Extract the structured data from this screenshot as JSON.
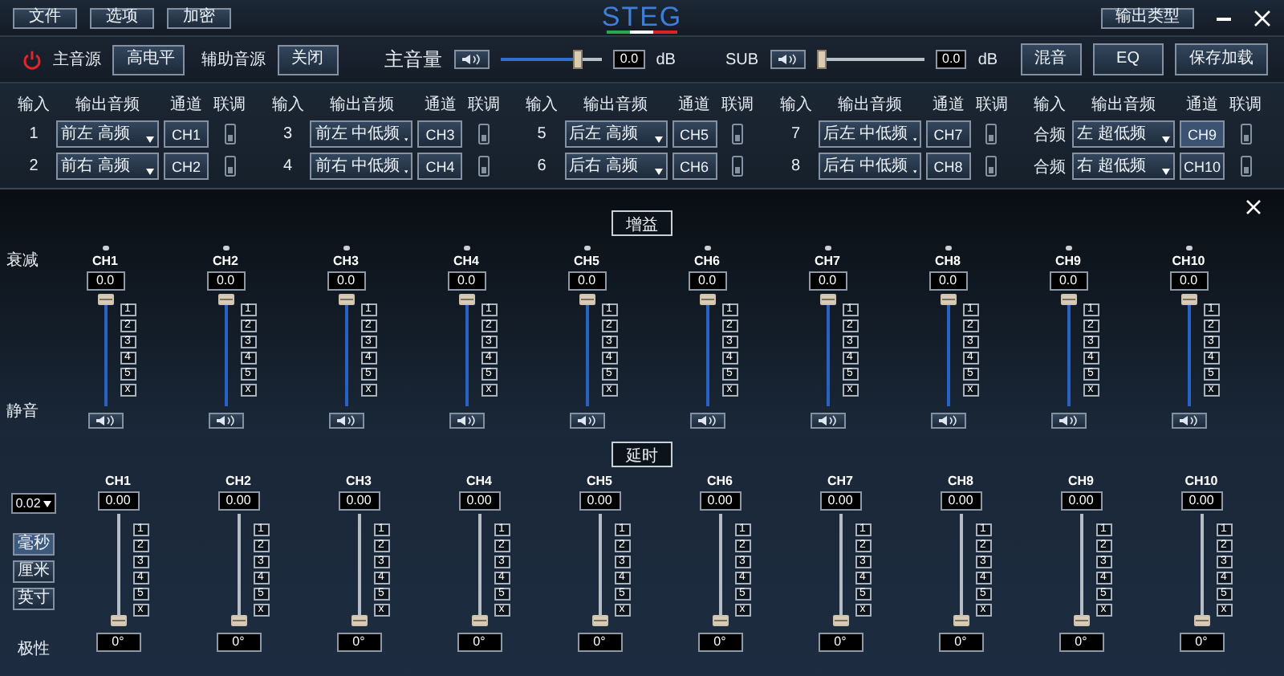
{
  "menu": [
    "文件",
    "选项",
    "加密"
  ],
  "logo": "STEG",
  "output_type_button": "输出类型",
  "controls": {
    "main_source": {
      "label": "主音源",
      "value": "高电平"
    },
    "aux_source": {
      "label": "辅助音源",
      "value": "关闭"
    },
    "master": {
      "label": "主音量",
      "muted": false,
      "level": 0.78,
      "value": "0.0",
      "unit": "dB"
    },
    "sub": {
      "label": "SUB",
      "muted": false,
      "level": 0,
      "value": "0.0",
      "unit": "dB"
    },
    "buttons": [
      "混音",
      "EQ",
      "保存加载"
    ]
  },
  "routing": {
    "groups": [
      {
        "headers": [
          "输入",
          "输出音频",
          "通道",
          "联调"
        ],
        "rows": [
          {
            "input": "1",
            "output": "前左 高频",
            "channel": "CH1",
            "selected": false,
            "linked": false
          },
          {
            "input": "2",
            "output": "前右 高频",
            "channel": "CH2",
            "selected": false,
            "linked": false
          }
        ]
      },
      {
        "headers": [
          "输入",
          "输出音频",
          "通道",
          "联调"
        ],
        "rows": [
          {
            "input": "3",
            "output": "前左 中低频",
            "channel": "CH3",
            "selected": false,
            "linked": false
          },
          {
            "input": "4",
            "output": "前右 中低频",
            "channel": "CH4",
            "selected": false,
            "linked": false
          }
        ]
      },
      {
        "headers": [
          "输入",
          "输出音频",
          "通道",
          "联调"
        ],
        "rows": [
          {
            "input": "5",
            "output": "后左 高频",
            "channel": "CH5",
            "selected": false,
            "linked": false
          },
          {
            "input": "6",
            "output": "后右 高频",
            "channel": "CH6",
            "selected": false,
            "linked": false
          }
        ]
      },
      {
        "headers": [
          "输入",
          "输出音频",
          "通道",
          "联调"
        ],
        "rows": [
          {
            "input": "7",
            "output": "后左 中低频",
            "channel": "CH7",
            "selected": false,
            "linked": false
          },
          {
            "input": "8",
            "output": "后右 中低频",
            "channel": "CH8",
            "selected": false,
            "linked": false
          }
        ]
      },
      {
        "headers": [
          "输入",
          "输出音频",
          "通道",
          "联调"
        ],
        "rows": [
          {
            "input": "合频",
            "output": "左 超低频",
            "channel": "CH9",
            "selected": true,
            "linked": false
          },
          {
            "input": "合频",
            "output": "右 超低频",
            "channel": "CH10",
            "selected": false,
            "linked": false
          }
        ]
      }
    ]
  },
  "gain": {
    "title": "增益",
    "attenuation_label": "衰减",
    "mute_label": "静音",
    "channels": [
      {
        "name": "CH1",
        "value": "0.0",
        "level": 1,
        "presets": [
          "1",
          "2",
          "3",
          "4",
          "5",
          "x"
        ],
        "muted": false
      },
      {
        "name": "CH2",
        "value": "0.0",
        "level": 1,
        "presets": [
          "1",
          "2",
          "3",
          "4",
          "5",
          "x"
        ],
        "muted": false
      },
      {
        "name": "CH3",
        "value": "0.0",
        "level": 1,
        "presets": [
          "1",
          "2",
          "3",
          "4",
          "5",
          "x"
        ],
        "muted": false
      },
      {
        "name": "CH4",
        "value": "0.0",
        "level": 1,
        "presets": [
          "1",
          "2",
          "3",
          "4",
          "5",
          "x"
        ],
        "muted": false
      },
      {
        "name": "CH5",
        "value": "0.0",
        "level": 1,
        "presets": [
          "1",
          "2",
          "3",
          "4",
          "5",
          "x"
        ],
        "muted": false
      },
      {
        "name": "CH6",
        "value": "0.0",
        "level": 1,
        "presets": [
          "1",
          "2",
          "3",
          "4",
          "5",
          "x"
        ],
        "muted": false
      },
      {
        "name": "CH7",
        "value": "0.0",
        "level": 1,
        "presets": [
          "1",
          "2",
          "3",
          "4",
          "5",
          "x"
        ],
        "muted": false
      },
      {
        "name": "CH8",
        "value": "0.0",
        "level": 1,
        "presets": [
          "1",
          "2",
          "3",
          "4",
          "5",
          "x"
        ],
        "muted": false
      },
      {
        "name": "CH9",
        "value": "0.0",
        "level": 1,
        "presets": [
          "1",
          "2",
          "3",
          "4",
          "5",
          "x"
        ],
        "muted": false
      },
      {
        "name": "CH10",
        "value": "0.0",
        "level": 1,
        "presets": [
          "1",
          "2",
          "3",
          "4",
          "5",
          "x"
        ],
        "muted": false
      }
    ]
  },
  "delay": {
    "title": "延时",
    "step": "0.02",
    "units": [
      {
        "label": "毫秒",
        "selected": true
      },
      {
        "label": "厘米",
        "selected": false
      },
      {
        "label": "英寸",
        "selected": false
      }
    ],
    "polarity_label": "极性",
    "channels": [
      {
        "name": "CH1",
        "value": "0.00",
        "level": 0,
        "presets": [
          "1",
          "2",
          "3",
          "4",
          "5",
          "x"
        ],
        "polarity": "0°"
      },
      {
        "name": "CH2",
        "value": "0.00",
        "level": 0,
        "presets": [
          "1",
          "2",
          "3",
          "4",
          "5",
          "x"
        ],
        "polarity": "0°"
      },
      {
        "name": "CH3",
        "value": "0.00",
        "level": 0,
        "presets": [
          "1",
          "2",
          "3",
          "4",
          "5",
          "x"
        ],
        "polarity": "0°"
      },
      {
        "name": "CH4",
        "value": "0.00",
        "level": 0,
        "presets": [
          "1",
          "2",
          "3",
          "4",
          "5",
          "x"
        ],
        "polarity": "0°"
      },
      {
        "name": "CH5",
        "value": "0.00",
        "level": 0,
        "presets": [
          "1",
          "2",
          "3",
          "4",
          "5",
          "x"
        ],
        "polarity": "0°"
      },
      {
        "name": "CH6",
        "value": "0.00",
        "level": 0,
        "presets": [
          "1",
          "2",
          "3",
          "4",
          "5",
          "x"
        ],
        "polarity": "0°"
      },
      {
        "name": "CH7",
        "value": "0.00",
        "level": 0,
        "presets": [
          "1",
          "2",
          "3",
          "4",
          "5",
          "x"
        ],
        "polarity": "0°"
      },
      {
        "name": "CH8",
        "value": "0.00",
        "level": 0,
        "presets": [
          "1",
          "2",
          "3",
          "4",
          "5",
          "x"
        ],
        "polarity": "0°"
      },
      {
        "name": "CH9",
        "value": "0.00",
        "level": 0,
        "presets": [
          "1",
          "2",
          "3",
          "4",
          "5",
          "x"
        ],
        "polarity": "0°"
      },
      {
        "name": "CH10",
        "value": "0.00",
        "level": 0,
        "presets": [
          "1",
          "2",
          "3",
          "4",
          "5",
          "x"
        ],
        "polarity": "0°"
      }
    ]
  }
}
